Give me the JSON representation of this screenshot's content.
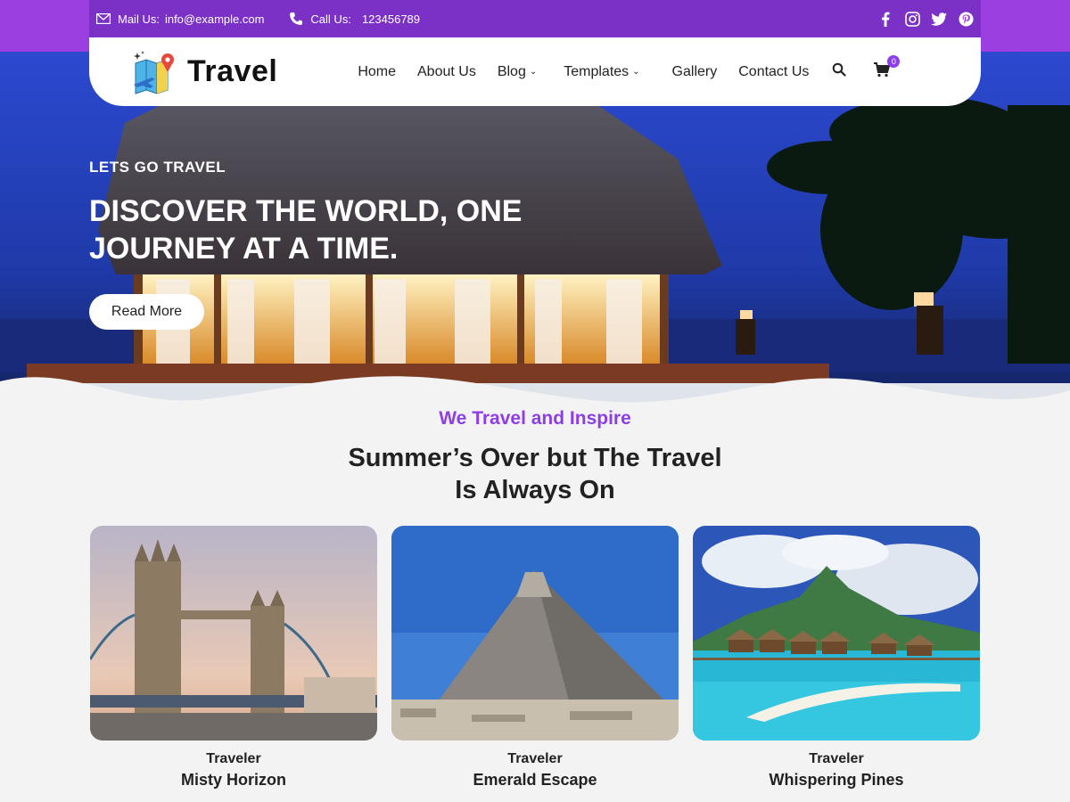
{
  "topbar": {
    "mail_label": "Mail Us:",
    "mail_value": "info@example.com",
    "call_label": "Call Us:",
    "call_value": "123456789",
    "social": [
      "facebook-icon",
      "instagram-icon",
      "twitter-icon",
      "pinterest-icon"
    ]
  },
  "header": {
    "logo_text": "Travel",
    "nav": {
      "home": "Home",
      "about": "About Us",
      "blog": "Blog",
      "templates": "Templates",
      "gallery": "Gallery",
      "contact": "Contact Us"
    },
    "cart_count": "0"
  },
  "hero": {
    "eyebrow": "LETS GO TRAVEL",
    "headline": "DISCOVER THE WORLD, ONE JOURNEY AT A TIME.",
    "button": "Read More"
  },
  "section": {
    "kicker": "We Travel and Inspire",
    "heading_line1": "Summer’s Over but The Travel",
    "heading_line2": "Is Always On"
  },
  "cards": [
    {
      "type": "Traveler",
      "name": "Misty Horizon"
    },
    {
      "type": "Traveler",
      "name": "Emerald Escape"
    },
    {
      "type": "Traveler",
      "name": "Whispering Pines"
    }
  ],
  "colors": {
    "brand_purple": "#7b31c6",
    "accent_purple": "#8e3ee6"
  }
}
